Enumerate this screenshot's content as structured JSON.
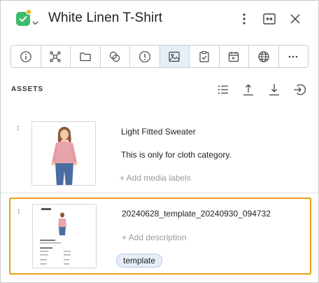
{
  "header": {
    "title": "White Linen T-Shirt",
    "status_icon": "check-square-icon",
    "status_color": "#3dbd6a",
    "status_dot_color": "#f4b400",
    "actions": [
      "more-vertical-icon",
      "expand-horizontal-icon",
      "close-icon"
    ]
  },
  "toolbar": {
    "tools": [
      {
        "name": "info-icon",
        "active": false
      },
      {
        "name": "relations-icon",
        "active": false
      },
      {
        "name": "folder-icon",
        "active": false
      },
      {
        "name": "variants-icon",
        "active": false
      },
      {
        "name": "alert-icon",
        "active": false
      },
      {
        "name": "image-icon",
        "active": true
      },
      {
        "name": "task-check-icon",
        "active": false
      },
      {
        "name": "calendar-icon",
        "active": false
      },
      {
        "name": "globe-icon",
        "active": false
      },
      {
        "name": "more-horizontal-icon",
        "active": false
      }
    ],
    "active_bg": "#e6eef8"
  },
  "assets": {
    "label": "ASSETS",
    "actions": [
      "list-icon",
      "upload-icon",
      "download-icon",
      "sign-in-icon"
    ],
    "items": [
      {
        "name": "Light Fitted Sweater",
        "description": "This is only for cloth category.",
        "add_link": "+ Add media labels",
        "thumbnail": "sweater-photo"
      },
      {
        "name": "20240628_template_20240930_094732",
        "add_link": "+ Add description",
        "tag": "template",
        "thumbnail": "template-document",
        "highlighted": true,
        "highlight_color": "#e8a317"
      }
    ]
  }
}
